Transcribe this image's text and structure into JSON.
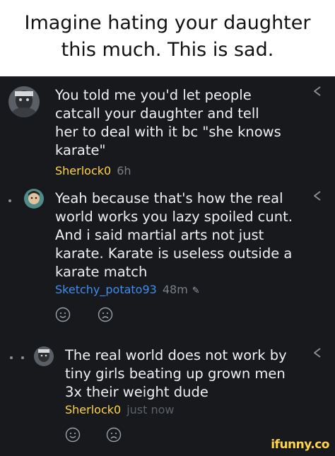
{
  "meme_caption": {
    "line1": "Imagine hating your daughter",
    "line2": "this much. This is sad."
  },
  "comments": [
    {
      "lines": [
        "You told me you'd let people",
        "catcall your daughter and tell",
        "her to deal with it bc \"she knows",
        "karate\""
      ],
      "username": "Sherlock0",
      "time": "6h"
    },
    {
      "lines": [
        "Yeah because that's how the real",
        "world works you lazy spoiled cunt.",
        "And i said martial arts not just",
        "karate. Karate is useless outside a",
        "karate match"
      ],
      "username": "Sketchy_potato93",
      "time": "48m"
    },
    {
      "lines": [
        "The real world does not work by",
        "tiny girls beating up grown men",
        "3x their weight dude"
      ],
      "username": "Sherlock0",
      "time": "just now"
    }
  ],
  "watermark": "ifunny.co",
  "colors": {
    "panel_bg": "#17191d",
    "username_yellow": "#ffd54a",
    "username_blue": "#3f8ef0",
    "text": "#eef0f3",
    "muted": "#7b7f86"
  },
  "icons": [
    "share-icon",
    "smile-reaction-icon",
    "frown-reaction-icon",
    "edit-pencil-icon"
  ]
}
